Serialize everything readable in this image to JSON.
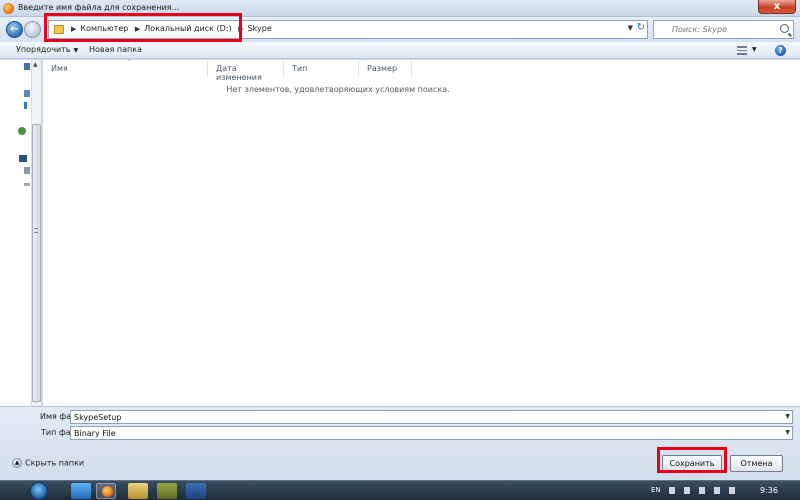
{
  "window": {
    "title": "Введите имя файла для сохранения...",
    "close_glyph": "x"
  },
  "address": {
    "crumbs": [
      "Компьютер",
      "Локальный диск (D:)",
      "Skype"
    ],
    "search_placeholder": "Поиск: Skype"
  },
  "toolbar": {
    "organize_label": "Упорядочить",
    "new_folder_label": "Новая папка",
    "help_glyph": "?"
  },
  "columns": [
    "Имя",
    "Дата изменения",
    "Тип",
    "Размер"
  ],
  "file_list": {
    "empty_message": "Нет элементов, удовлетворяющих условиям поиска."
  },
  "form": {
    "filename_label": "Имя файла:",
    "filename_value": "SkypeSetup",
    "filetype_label": "Тип файла:",
    "filetype_value": "Binary File",
    "hide_folders_label": "Скрыть папки",
    "save_label": "Сохранить",
    "cancel_label": "Отмена"
  },
  "taskbar": {
    "language": "EN",
    "time": "9:36"
  },
  "colors": {
    "highlight": "#e8001a",
    "accent": "#2f6fb7"
  }
}
